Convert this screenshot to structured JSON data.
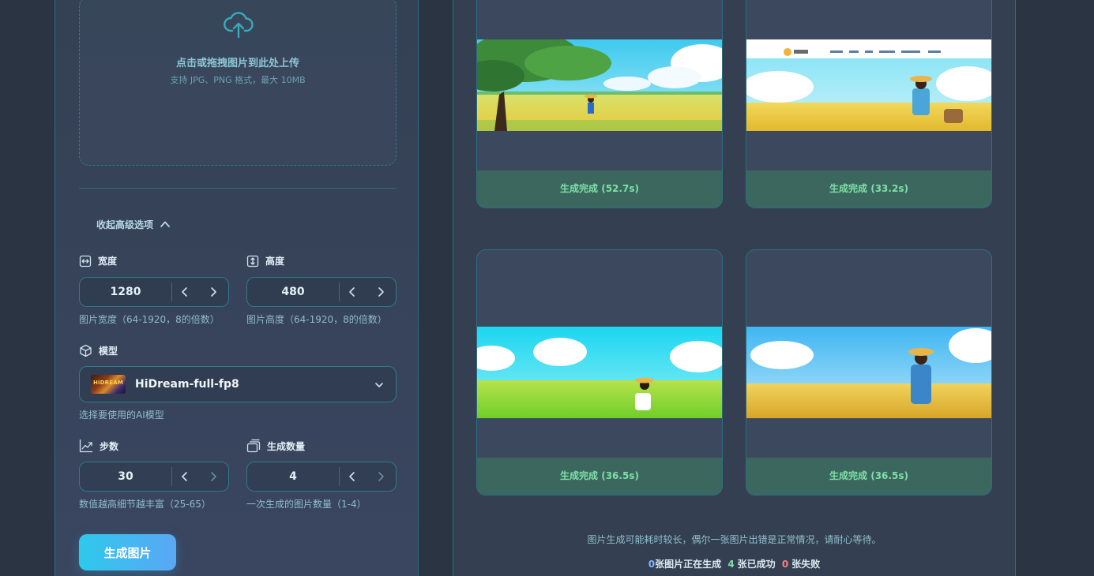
{
  "upload": {
    "title": "点击或拖拽图片到此处上传",
    "hint": "支持 JPG、PNG 格式，最大 10MB"
  },
  "advanced": {
    "toggle_label": "收起高级选项"
  },
  "width": {
    "label": "宽度",
    "value": "1280",
    "hint": "图片宽度（64-1920，8的倍数）"
  },
  "height": {
    "label": "高度",
    "value": "480",
    "hint": "图片高度（64-1920，8的倍数）"
  },
  "model": {
    "label": "模型",
    "thumb_text": "HiDREAM",
    "selected": "HiDream-full-fp8",
    "hint": "选择要使用的AI模型"
  },
  "steps": {
    "label": "步数",
    "value": "30",
    "hint": "数值越高细节越丰富（25-65）"
  },
  "count": {
    "label": "生成数量",
    "value": "4",
    "hint": "一次生成的图片数量（1-4）"
  },
  "generate_button": "生成图片",
  "results": [
    {
      "status": "生成完成 (52.7s)"
    },
    {
      "status": "生成完成 (33.2s)"
    },
    {
      "status": "生成完成 (36.5s)"
    },
    {
      "status": "生成完成 (36.5s)"
    }
  ],
  "notice": "图片生成可能耗时较长，偶尔一张图片出错是正常情况，请耐心等待。",
  "summary": {
    "pending_count": "0",
    "pending_label": "张图片正在生成",
    "success_count": "4",
    "success_label": "张已成功",
    "fail_count": "0",
    "fail_label": "张失败"
  },
  "colors": {
    "accent": "#2ec9ec",
    "success": "#7fe0a6",
    "fail": "#ff7d86",
    "pending": "#7fb7ff"
  },
  "icons": [
    "upload-cloud-icon",
    "chevron-up-icon",
    "width-arrows-icon",
    "height-arrows-icon",
    "cube-icon",
    "chevron-left-icon",
    "chevron-right-icon",
    "chevron-down-icon",
    "chart-line-icon",
    "stack-icon"
  ]
}
